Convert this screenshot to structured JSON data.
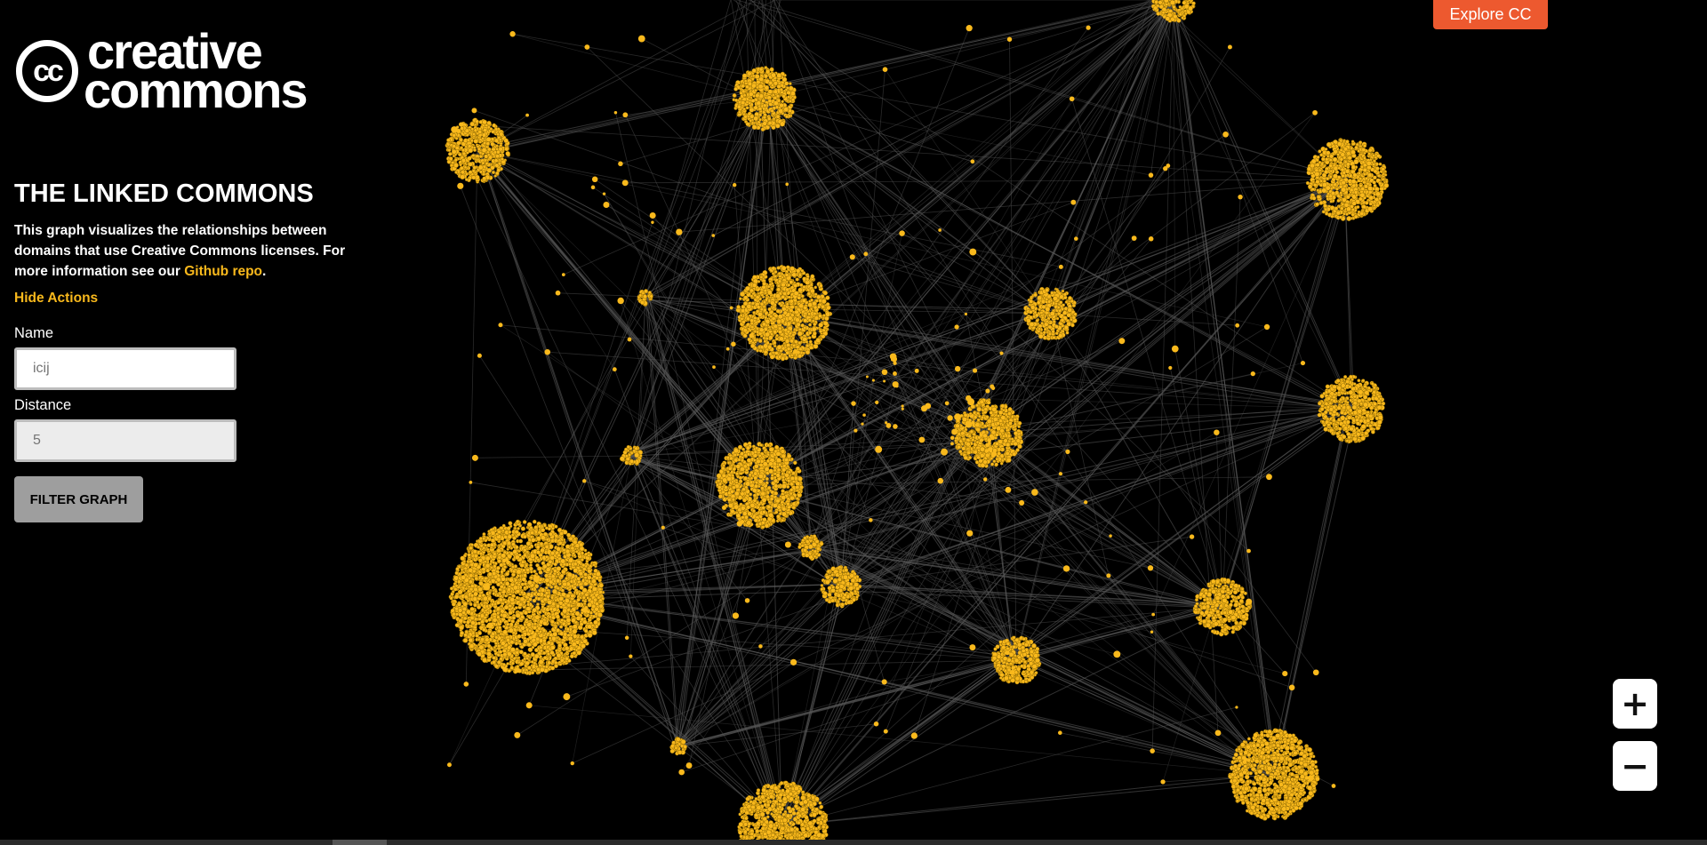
{
  "logo": {
    "mark": "cc",
    "line1": "creative",
    "line2": "commons"
  },
  "sidebar": {
    "title": "THE LINKED COMMONS",
    "description_prefix": "This graph visualizes the relationships between domains that use Creative Commons licenses. For more information see our ",
    "github_link": "Github repo",
    "description_suffix": ".",
    "hide_actions": "Hide Actions",
    "name_label": "Name",
    "name_placeholder": "icij",
    "distance_label": "Distance",
    "distance_placeholder": "5",
    "filter_button": "FILTER GRAPH"
  },
  "header": {
    "explore_button": "Explore CC"
  },
  "zoom": {
    "zoom_in_icon": "plus-icon",
    "zoom_out_icon": "minus-icon"
  },
  "colors": {
    "background": "#000000",
    "node": "#f9b91c",
    "edge": "#5a5a5a",
    "accent": "#ed592f",
    "link": "#f9b91c"
  }
}
